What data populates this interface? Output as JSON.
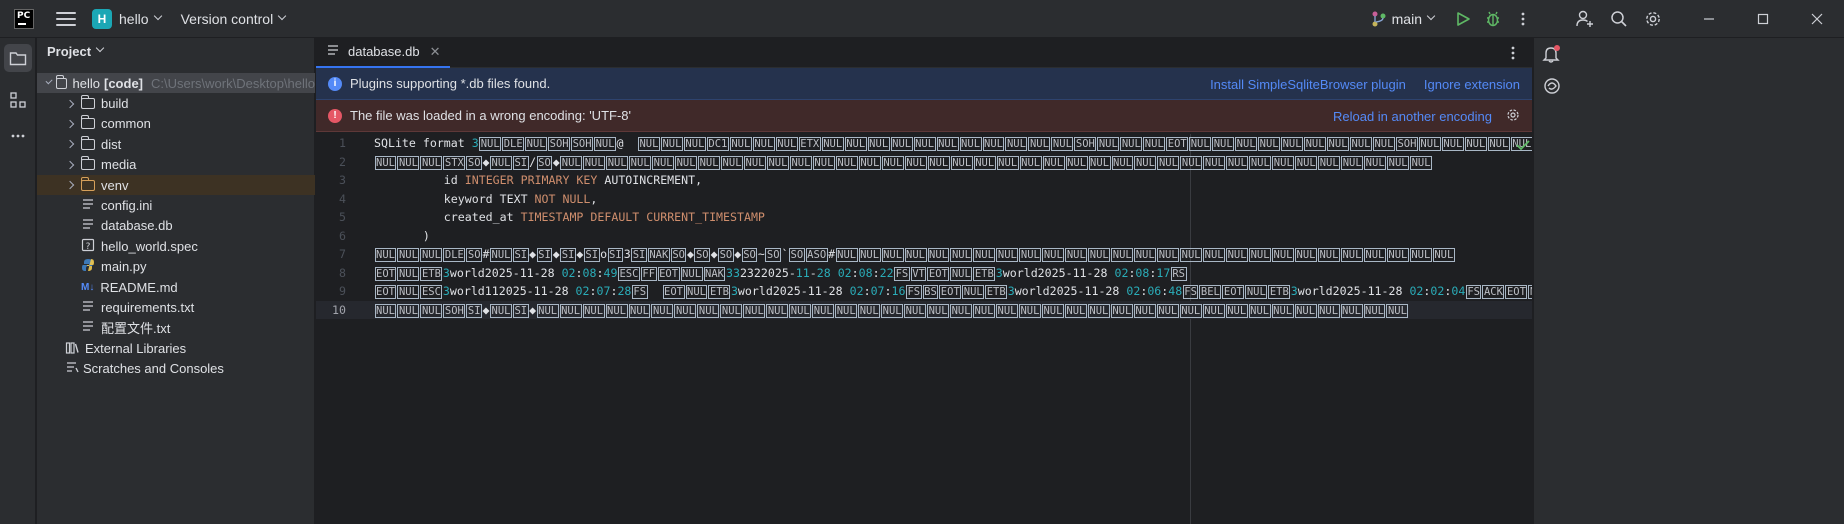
{
  "titlebar": {
    "logo_text": "PC",
    "project_letter": "H",
    "project_name": "hello",
    "vcs_label": "Version control",
    "branch": "main"
  },
  "project_panel": {
    "title": "Project",
    "root": {
      "name": "hello",
      "module": "[code]",
      "path": "C:\\Users\\work\\Desktop\\hello"
    },
    "items": [
      {
        "label": "build",
        "type": "folder"
      },
      {
        "label": "common",
        "type": "folder"
      },
      {
        "label": "dist",
        "type": "folder"
      },
      {
        "label": "media",
        "type": "folder"
      },
      {
        "label": "venv",
        "type": "folder-excluded"
      },
      {
        "label": "config.ini",
        "type": "file"
      },
      {
        "label": "database.db",
        "type": "file"
      },
      {
        "label": "hello_world.spec",
        "type": "file"
      },
      {
        "label": "main.py",
        "type": "python"
      },
      {
        "label": "README.md",
        "type": "markdown"
      },
      {
        "label": "requirements.txt",
        "type": "file"
      },
      {
        "label": "配置文件.txt",
        "type": "file"
      }
    ],
    "external_libraries": "External Libraries",
    "scratches": "Scratches and Consoles"
  },
  "editor": {
    "tab_label": "database.db",
    "info_banner": {
      "text": "Plugins supporting *.db files found.",
      "action1": "Install SimpleSqliteBrowser plugin",
      "action2": "Ignore extension"
    },
    "warn_banner": {
      "text": "The file was loaded in a wrong encoding: 'UTF-8'",
      "action": "Reload in another encoding"
    },
    "line_numbers": [
      "1",
      "2",
      "3",
      "4",
      "5",
      "6",
      "7",
      "8",
      "9",
      "10"
    ]
  },
  "colors": {
    "accent": "#3574f0",
    "link": "#548af7",
    "keyword": "#cf8e6d",
    "number": "#2aacb8",
    "run_green": "#5fb865"
  }
}
